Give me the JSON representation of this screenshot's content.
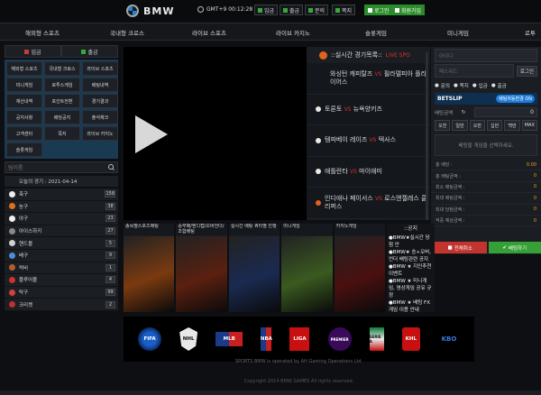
{
  "header": {
    "brand": "BMW",
    "clock": "GMT+9 00:12:28",
    "buttons": [
      {
        "label": "입금",
        "style": "dark"
      },
      {
        "label": "출금",
        "style": "dark"
      },
      {
        "label": "문의",
        "style": "dark"
      },
      {
        "label": "쪽지",
        "style": "dark"
      },
      {
        "label": "로그인",
        "style": "green"
      },
      {
        "label": "회원가입",
        "style": "green"
      }
    ]
  },
  "nav": [
    "해외형 스포츠",
    "국내형 크로스",
    "라이브 스포츠",
    "라이브 카지노",
    "슬롯게임",
    "미니게임",
    "로투"
  ],
  "sidebar": {
    "deposit": "입금",
    "withdraw": "출금",
    "grid": [
      "해외형 스포츠",
      "국내형 크로스",
      "라이브 스포츠",
      "미니게임",
      "로투스게임",
      "배팅내역",
      "재산내역",
      "포인트전환",
      "경기결과",
      "공지사항",
      "배당공지",
      "출석체크",
      "고객센터",
      "쪽지",
      "라이브 카지노",
      "슬롯게임"
    ],
    "search_placeholder": "팀이름",
    "today_label": "오늘의 경기 : 2021-04-14",
    "sports": [
      {
        "name": "축구",
        "count": "158",
        "color": "#eeeeee"
      },
      {
        "name": "농구",
        "count": "38",
        "color": "#e07020"
      },
      {
        "name": "야구",
        "count": "23",
        "color": "#f0f0f0"
      },
      {
        "name": "아이스하키",
        "count": "27",
        "color": "#888888"
      },
      {
        "name": "핸드볼",
        "count": "5",
        "color": "#d0d0d0"
      },
      {
        "name": "배구",
        "count": "9",
        "color": "#4a90d8"
      },
      {
        "name": "럭비",
        "count": "1",
        "color": "#b06030"
      },
      {
        "name": "플루어볼",
        "count": "4",
        "color": "#d03030"
      },
      {
        "name": "탁구",
        "count": "99",
        "color": "#d04040"
      },
      {
        "name": "크리켓",
        "count": "2",
        "color": "#c03030"
      }
    ]
  },
  "live": {
    "title": "::실시간 경기목록::",
    "tag": "LIVE SPO",
    "vs": "VS",
    "matches": [
      {
        "home": "와싱턴 캐피탈즈",
        "away": "필라델피아 플라이어스"
      },
      {
        "home": "토론토",
        "away": "뉴욕양키즈"
      },
      {
        "home": "템파베이 레이즈",
        "away": "텍사스"
      },
      {
        "home": "애틀란타",
        "away": "마이애미"
      },
      {
        "home": "인디애나 페이서스",
        "away": "로스앤젤레스 클리퍼스"
      }
    ]
  },
  "betslip": {
    "id_placeholder": "아이디",
    "pw_placeholder": "패스워드",
    "login": "로그인",
    "tabs": [
      "문의",
      "쪽지",
      "입금",
      "출금"
    ],
    "title": "BETSLIP",
    "auto": "배팅자동변경 ON",
    "amount_label": "배팅금액",
    "amount": "0",
    "chips": [
      "오천",
      "일만",
      "오만",
      "십만",
      "백만",
      "MAX"
    ],
    "message": "배팅할 게임을 선택하세요.",
    "info": [
      {
        "label": "총 배당 :",
        "value": "0.00"
      },
      {
        "label": "총 배팅금액 :",
        "value": "0"
      },
      {
        "label": "최소 배팅금액 :",
        "value": "0"
      },
      {
        "label": "최대 배팅금액 :",
        "value": "0"
      },
      {
        "label": "최대 당첨금액 :",
        "value": "0"
      },
      {
        "label": "적중 예상금액 :",
        "value": "0"
      }
    ],
    "clear": "전체취소",
    "place": "배팅하기"
  },
  "cards": [
    {
      "title": "종목별스포츠배팅",
      "color": "#7a3a10"
    },
    {
      "title": "승무패/핸디캡/오버언더/조합배팅",
      "color": "#5a2010"
    },
    {
      "title": "실시간 배팅 쿼터별 진행",
      "color": "#1a2a50"
    },
    {
      "title": "미니게임",
      "color": "#3a5a20"
    },
    {
      "title": "카지노게임",
      "color": "#4a1010"
    }
  ],
  "notice": {
    "title": "::공지",
    "items": [
      "●BMW★실시간 당첨 안",
      "●BMW★ 승+오버,언더 배팅관련 공지",
      "●BMW ★ 지인추천 이벤트",
      "●BMW ★ 미니게임, 영상게임 공유 규정",
      "●BMW ★ 배팅 FX 게임 이용 안내"
    ]
  },
  "logos": [
    "FIFA",
    "NHL",
    "MLB",
    "NBA",
    "LIGA",
    "PREMIER",
    "SERIE A",
    "KHL",
    "KBO"
  ],
  "footer": {
    "line1": "SPORTS BMW is operated by AH Gaming Operations Ltd.",
    "line2": "Copyright 2014 BMW GAMES All rights reserved."
  }
}
